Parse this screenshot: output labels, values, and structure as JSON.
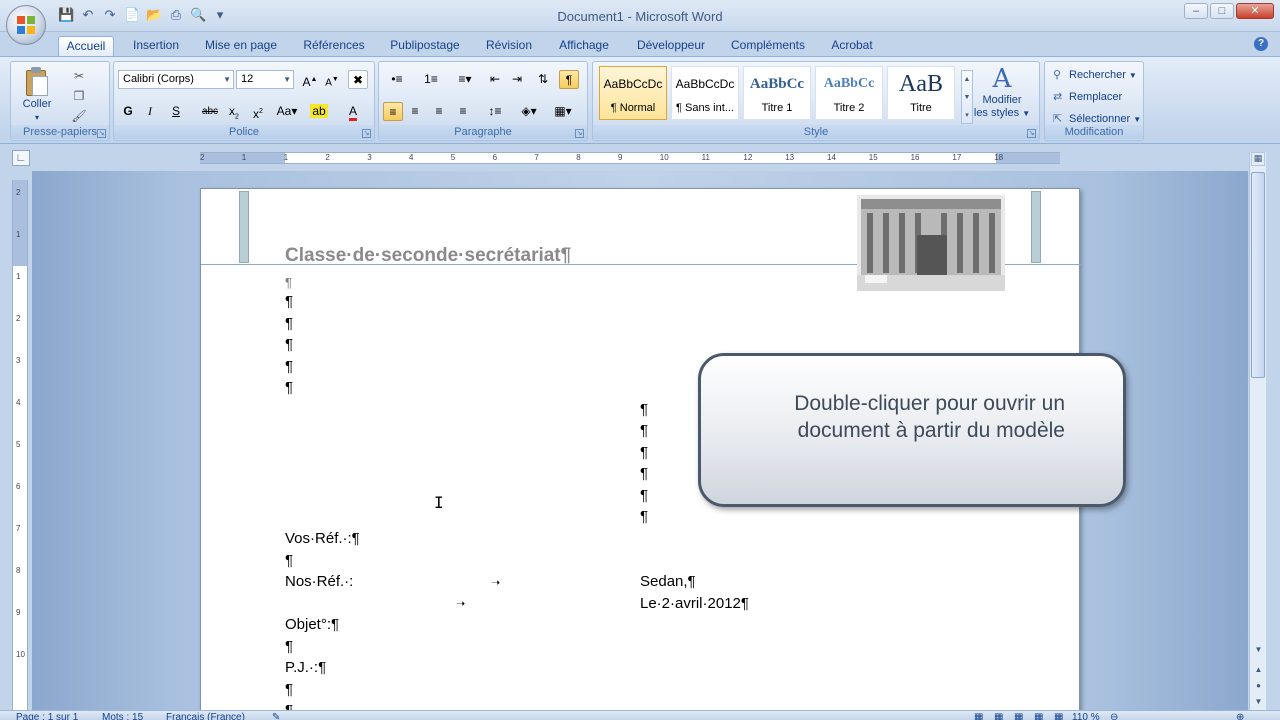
{
  "window": {
    "title": "Document1 - Microsoft Word"
  },
  "tabs": [
    "Accueil",
    "Insertion",
    "Mise en page",
    "Références",
    "Publipostage",
    "Révision",
    "Affichage",
    "Développeur",
    "Compléments",
    "Acrobat"
  ],
  "ribbon": {
    "clipboard": {
      "paste_label": "Coller",
      "group_label": "Presse-papiers"
    },
    "font": {
      "family": "Calibri (Corps)",
      "size": "12",
      "group_label": "Police"
    },
    "paragraph": {
      "group_label": "Paragraphe"
    },
    "styles": {
      "items": [
        {
          "sample": "AaBbCcDc",
          "name": "¶ Normal"
        },
        {
          "sample": "AaBbCcDc",
          "name": "¶ Sans int..."
        },
        {
          "sample": "AaBbCc",
          "name": "Titre 1"
        },
        {
          "sample": "AaBbCc",
          "name": "Titre 2"
        },
        {
          "sample": "AaB",
          "name": "Titre"
        }
      ],
      "modify_label_1": "Modifier",
      "modify_label_2": "les styles",
      "group_label": "Style"
    },
    "editing": {
      "find": "Rechercher",
      "replace": "Remplacer",
      "select": "Sélectionner",
      "group_label": "Modification"
    }
  },
  "ruler": {
    "h_ticks": [
      "2",
      "1",
      "1",
      "2",
      "3",
      "4",
      "5",
      "6",
      "7",
      "8",
      "9",
      "10",
      "11",
      "12",
      "13",
      "14",
      "15",
      "16",
      "17",
      "18"
    ],
    "v_ticks": [
      "2",
      "1",
      "1",
      "2",
      "3",
      "4",
      "5",
      "6",
      "7",
      "8",
      "9",
      "10"
    ]
  },
  "document": {
    "header_title": "Classe·de·seconde·secrétariat¶",
    "pilcrow": "¶",
    "vos_ref": "Vos·Réf.·:¶",
    "nos_ref": "Nos·Réf.·:",
    "city": "Sedan,¶",
    "date": "Le·2·avril·2012¶",
    "objet": "Objet°:¶",
    "pj": "P.J.·:¶"
  },
  "callout": {
    "line1": "Double-cliquer pour ouvrir un",
    "line2": "document à partir du modèle"
  },
  "statusbar": {
    "page": "Page : 1 sur 1",
    "words": "Mots : 15",
    "language": "Français (France)",
    "zoom": "110 %"
  }
}
